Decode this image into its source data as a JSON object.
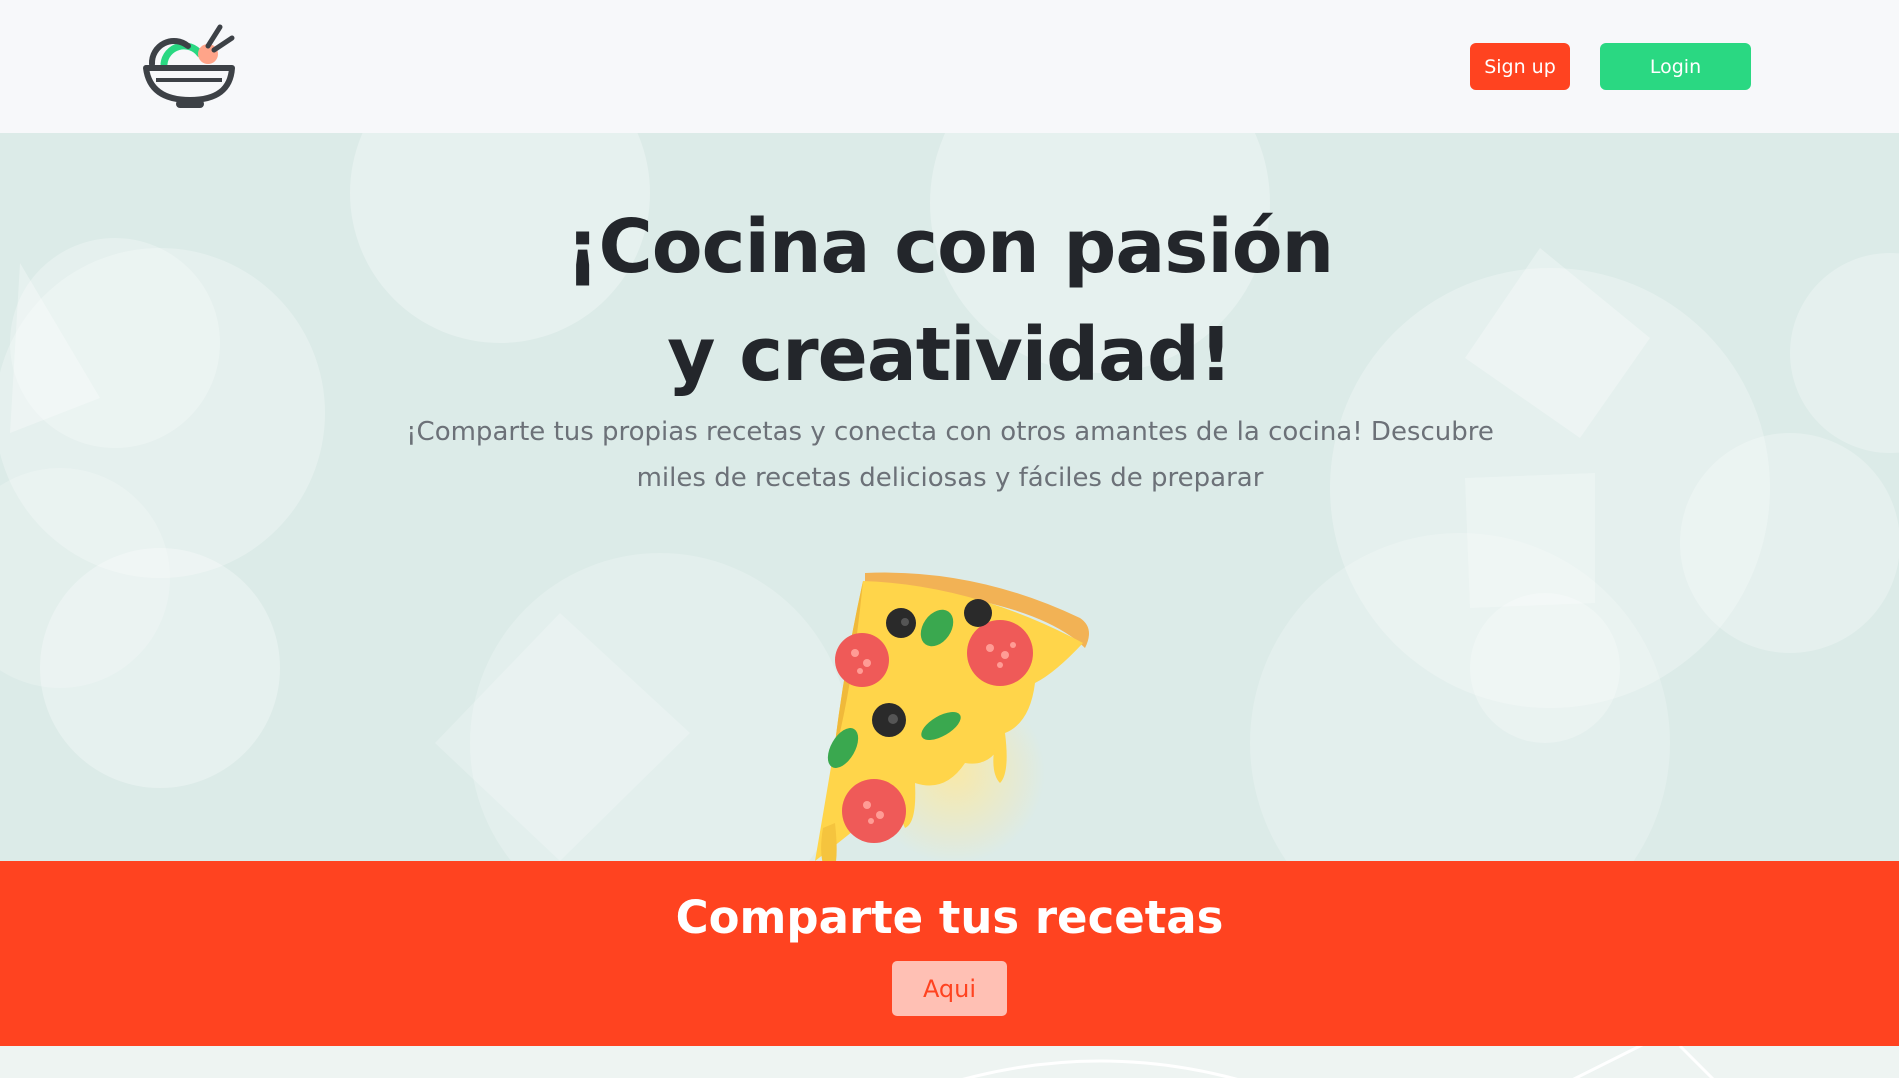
{
  "header": {
    "signup_label": "Sign up",
    "login_label": "Login"
  },
  "hero": {
    "title_line1": "¡Cocina con pasión",
    "title_line2": "y creatividad!",
    "description": "¡Comparte tus propias recetas y conecta con otros amantes de la cocina! Descubre miles de recetas deliciosas y fáciles de preparar"
  },
  "cta": {
    "title": "Comparte tus recetas",
    "button_label": "Aqui"
  },
  "colors": {
    "brand_red": "#ff4320",
    "brand_green": "#2ad882",
    "hero_bg": "#dcebe8",
    "text_dark": "#23262b"
  },
  "icons": {
    "logo": "bowl-logo-icon",
    "illustration": "pizza-slice-illustration"
  }
}
